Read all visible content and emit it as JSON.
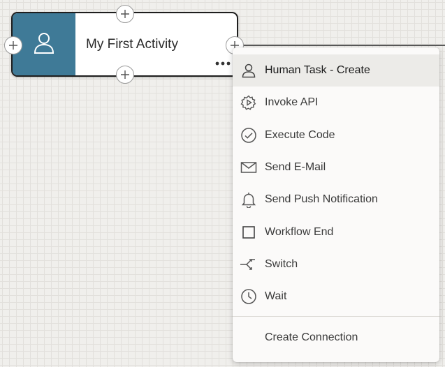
{
  "node": {
    "title": "My First Activity",
    "icon": "person-icon",
    "accent_color": "#3f7a97"
  },
  "menu": {
    "items": [
      {
        "label": "Human Task - Create",
        "icon": "person-icon",
        "selected": true
      },
      {
        "label": "Invoke API",
        "icon": "gear-play-icon"
      },
      {
        "label": "Execute Code",
        "icon": "check-circle-icon"
      },
      {
        "label": "Send E-Mail",
        "icon": "envelope-icon"
      },
      {
        "label": "Send Push Notification",
        "icon": "bell-icon"
      },
      {
        "label": "Workflow End",
        "icon": "square-icon"
      },
      {
        "label": "Switch",
        "icon": "switch-icon"
      },
      {
        "label": "Wait",
        "icon": "clock-icon"
      }
    ],
    "footer_item": "Create Connection"
  },
  "colors": {
    "canvas_background": "#f0efec",
    "highlight": "#ecebe8"
  }
}
